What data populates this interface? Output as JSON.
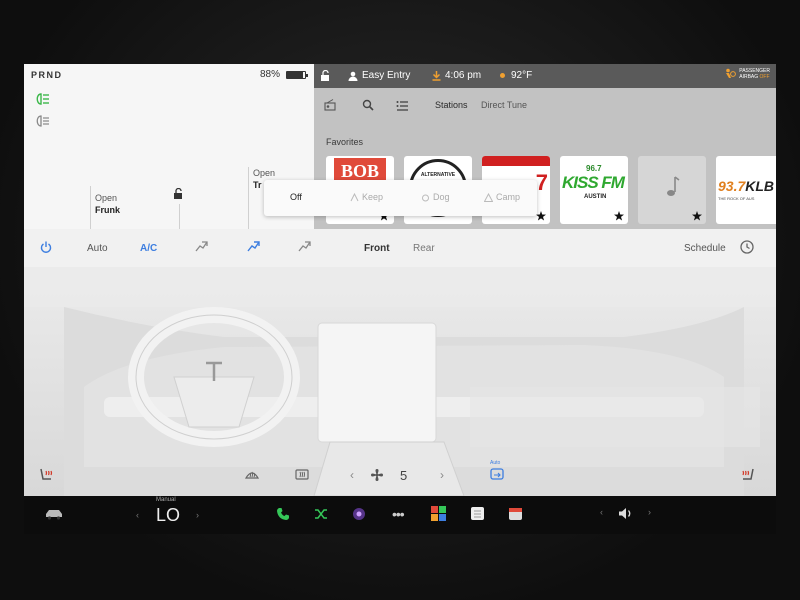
{
  "car": {
    "gear": "PRND",
    "battery_percent": "88%",
    "battery_level": 0.88,
    "frunk_top": "Open",
    "frunk_bottom": "Frunk",
    "trunk_top": "Open",
    "trunk_bottom": "Tr"
  },
  "status_bar": {
    "profile": "Easy Entry",
    "time": "4:06 pm",
    "temperature": "92°F",
    "airbag_line1": "PASSENGER",
    "airbag_line2": "AIRBAG",
    "airbag_state": "OFF"
  },
  "media": {
    "tabs": [
      "Stations",
      "Direct Tune"
    ],
    "favorites_label": "Favorites",
    "stations": [
      {
        "name": "BOB",
        "bg": "#ffffff"
      },
      {
        "name": "ALTERNATIVE",
        "bg": "#ffffff"
      },
      {
        "name": ".7",
        "bg": "#ffffff"
      },
      {
        "name": "KISS FM",
        "freq": "96.7",
        "city": "AUSTIN",
        "bg": "#ffffff"
      },
      {
        "name": "music-note",
        "bg": "#d6d6d6"
      },
      {
        "name": "KLB",
        "freq": "93.7",
        "sub": "THE ROCK OF AUS",
        "bg": "#ffffff"
      }
    ]
  },
  "climate_modes": {
    "off": "Off",
    "keep": "Keep",
    "dog": "Dog",
    "camp": "Camp"
  },
  "climate": {
    "auto": "Auto",
    "ac": "A/C",
    "front": "Front",
    "rear": "Rear",
    "schedule": "Schedule",
    "fan_speed": "5",
    "recirc_label": "Auto"
  },
  "dock": {
    "temp_mode": "Manual",
    "temp_value": "LO"
  },
  "colors": {
    "accent": "#3d7ee0",
    "phone": "#35c759",
    "bezel": "#141414"
  }
}
